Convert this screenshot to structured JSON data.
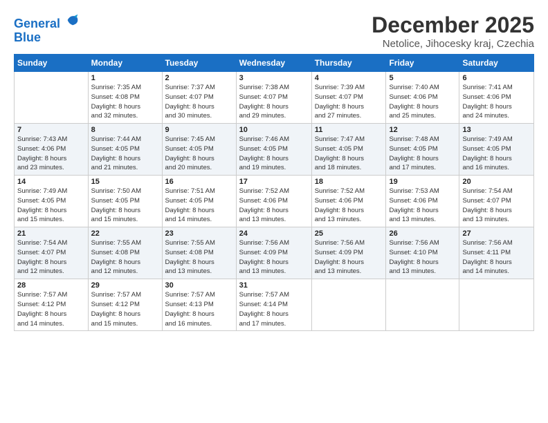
{
  "logo": {
    "line1": "General",
    "line2": "Blue"
  },
  "title": "December 2025",
  "subtitle": "Netolice, Jihocesky kraj, Czechia",
  "header_days": [
    "Sunday",
    "Monday",
    "Tuesday",
    "Wednesday",
    "Thursday",
    "Friday",
    "Saturday"
  ],
  "weeks": [
    [
      {
        "day": "",
        "info": ""
      },
      {
        "day": "1",
        "info": "Sunrise: 7:35 AM\nSunset: 4:08 PM\nDaylight: 8 hours\nand 32 minutes."
      },
      {
        "day": "2",
        "info": "Sunrise: 7:37 AM\nSunset: 4:07 PM\nDaylight: 8 hours\nand 30 minutes."
      },
      {
        "day": "3",
        "info": "Sunrise: 7:38 AM\nSunset: 4:07 PM\nDaylight: 8 hours\nand 29 minutes."
      },
      {
        "day": "4",
        "info": "Sunrise: 7:39 AM\nSunset: 4:07 PM\nDaylight: 8 hours\nand 27 minutes."
      },
      {
        "day": "5",
        "info": "Sunrise: 7:40 AM\nSunset: 4:06 PM\nDaylight: 8 hours\nand 25 minutes."
      },
      {
        "day": "6",
        "info": "Sunrise: 7:41 AM\nSunset: 4:06 PM\nDaylight: 8 hours\nand 24 minutes."
      }
    ],
    [
      {
        "day": "7",
        "info": "Sunrise: 7:43 AM\nSunset: 4:06 PM\nDaylight: 8 hours\nand 23 minutes."
      },
      {
        "day": "8",
        "info": "Sunrise: 7:44 AM\nSunset: 4:05 PM\nDaylight: 8 hours\nand 21 minutes."
      },
      {
        "day": "9",
        "info": "Sunrise: 7:45 AM\nSunset: 4:05 PM\nDaylight: 8 hours\nand 20 minutes."
      },
      {
        "day": "10",
        "info": "Sunrise: 7:46 AM\nSunset: 4:05 PM\nDaylight: 8 hours\nand 19 minutes."
      },
      {
        "day": "11",
        "info": "Sunrise: 7:47 AM\nSunset: 4:05 PM\nDaylight: 8 hours\nand 18 minutes."
      },
      {
        "day": "12",
        "info": "Sunrise: 7:48 AM\nSunset: 4:05 PM\nDaylight: 8 hours\nand 17 minutes."
      },
      {
        "day": "13",
        "info": "Sunrise: 7:49 AM\nSunset: 4:05 PM\nDaylight: 8 hours\nand 16 minutes."
      }
    ],
    [
      {
        "day": "14",
        "info": "Sunrise: 7:49 AM\nSunset: 4:05 PM\nDaylight: 8 hours\nand 15 minutes."
      },
      {
        "day": "15",
        "info": "Sunrise: 7:50 AM\nSunset: 4:05 PM\nDaylight: 8 hours\nand 15 minutes."
      },
      {
        "day": "16",
        "info": "Sunrise: 7:51 AM\nSunset: 4:05 PM\nDaylight: 8 hours\nand 14 minutes."
      },
      {
        "day": "17",
        "info": "Sunrise: 7:52 AM\nSunset: 4:06 PM\nDaylight: 8 hours\nand 13 minutes."
      },
      {
        "day": "18",
        "info": "Sunrise: 7:52 AM\nSunset: 4:06 PM\nDaylight: 8 hours\nand 13 minutes."
      },
      {
        "day": "19",
        "info": "Sunrise: 7:53 AM\nSunset: 4:06 PM\nDaylight: 8 hours\nand 13 minutes."
      },
      {
        "day": "20",
        "info": "Sunrise: 7:54 AM\nSunset: 4:07 PM\nDaylight: 8 hours\nand 13 minutes."
      }
    ],
    [
      {
        "day": "21",
        "info": "Sunrise: 7:54 AM\nSunset: 4:07 PM\nDaylight: 8 hours\nand 12 minutes."
      },
      {
        "day": "22",
        "info": "Sunrise: 7:55 AM\nSunset: 4:08 PM\nDaylight: 8 hours\nand 12 minutes."
      },
      {
        "day": "23",
        "info": "Sunrise: 7:55 AM\nSunset: 4:08 PM\nDaylight: 8 hours\nand 13 minutes."
      },
      {
        "day": "24",
        "info": "Sunrise: 7:56 AM\nSunset: 4:09 PM\nDaylight: 8 hours\nand 13 minutes."
      },
      {
        "day": "25",
        "info": "Sunrise: 7:56 AM\nSunset: 4:09 PM\nDaylight: 8 hours\nand 13 minutes."
      },
      {
        "day": "26",
        "info": "Sunrise: 7:56 AM\nSunset: 4:10 PM\nDaylight: 8 hours\nand 13 minutes."
      },
      {
        "day": "27",
        "info": "Sunrise: 7:56 AM\nSunset: 4:11 PM\nDaylight: 8 hours\nand 14 minutes."
      }
    ],
    [
      {
        "day": "28",
        "info": "Sunrise: 7:57 AM\nSunset: 4:12 PM\nDaylight: 8 hours\nand 14 minutes."
      },
      {
        "day": "29",
        "info": "Sunrise: 7:57 AM\nSunset: 4:12 PM\nDaylight: 8 hours\nand 15 minutes."
      },
      {
        "day": "30",
        "info": "Sunrise: 7:57 AM\nSunset: 4:13 PM\nDaylight: 8 hours\nand 16 minutes."
      },
      {
        "day": "31",
        "info": "Sunrise: 7:57 AM\nSunset: 4:14 PM\nDaylight: 8 hours\nand 17 minutes."
      },
      {
        "day": "",
        "info": ""
      },
      {
        "day": "",
        "info": ""
      },
      {
        "day": "",
        "info": ""
      }
    ]
  ]
}
